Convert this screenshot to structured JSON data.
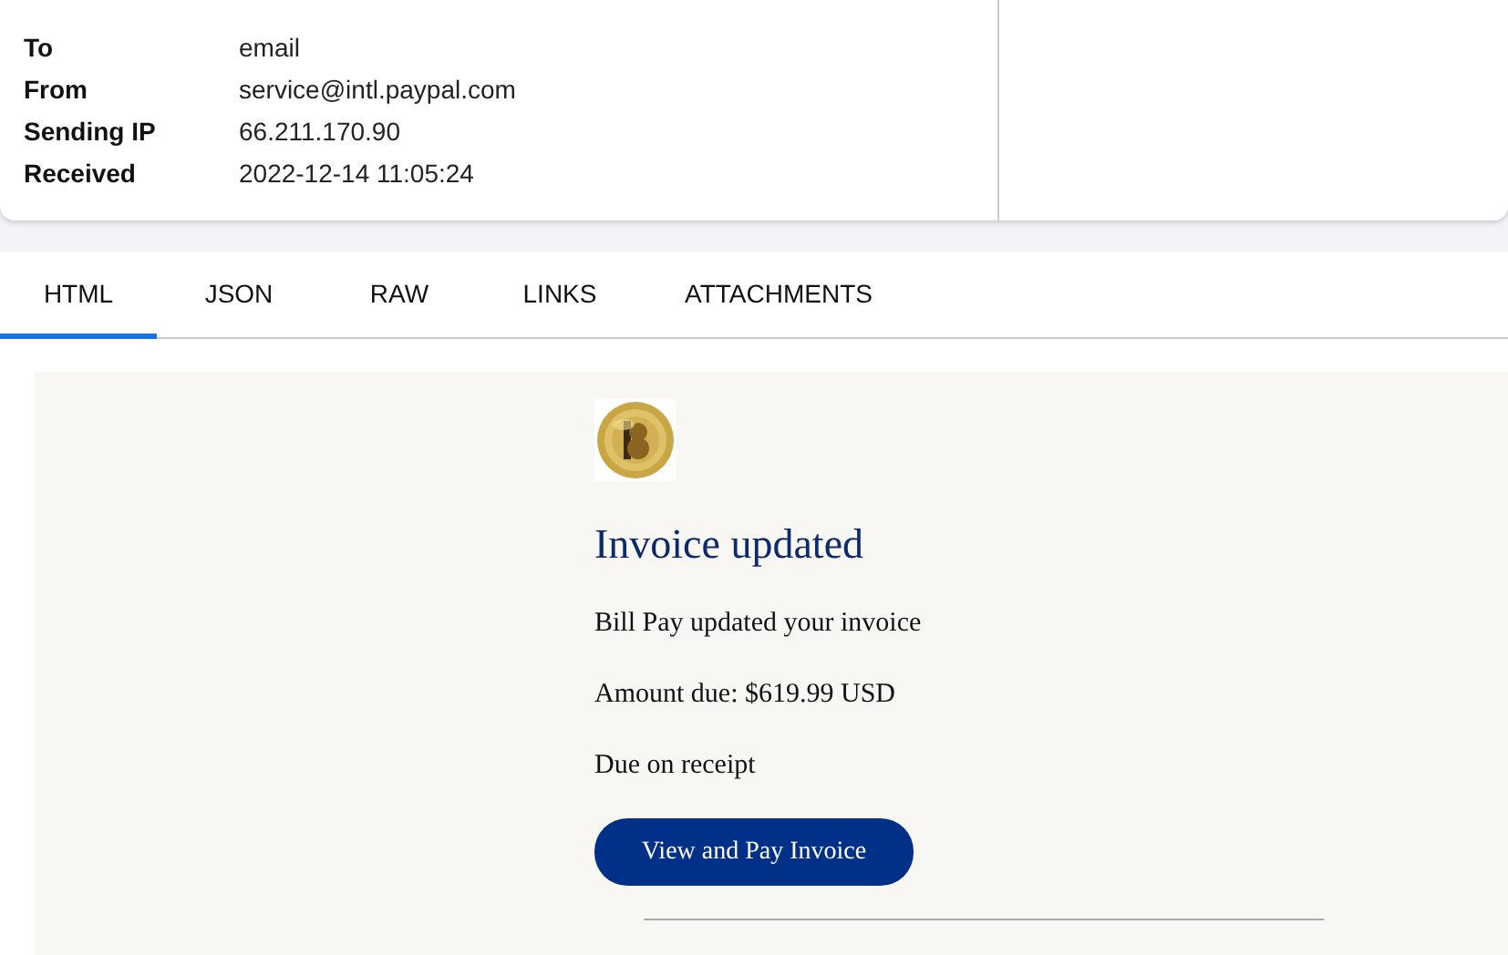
{
  "headers": [
    {
      "label": "To",
      "value": "email"
    },
    {
      "label": "From",
      "value": "service@intl.paypal.com"
    },
    {
      "label": "Sending IP",
      "value": "66.211.170.90"
    },
    {
      "label": "Received",
      "value": "2022-12-14 11:05:24"
    }
  ],
  "tabs": [
    {
      "label": "HTML",
      "selected": true
    },
    {
      "label": "JSON",
      "selected": false
    },
    {
      "label": "RAW",
      "selected": false
    },
    {
      "label": "LINKS",
      "selected": false
    },
    {
      "label": "ATTACHMENTS",
      "selected": false
    }
  ],
  "email": {
    "logo": {
      "kind": "picture"
    },
    "title": "Invoice updated",
    "lines": [
      "Bill Pay updated your invoice",
      "Amount due: $619.99 USD",
      "Due on receipt"
    ],
    "button": "View and Pay Invoice"
  }
}
